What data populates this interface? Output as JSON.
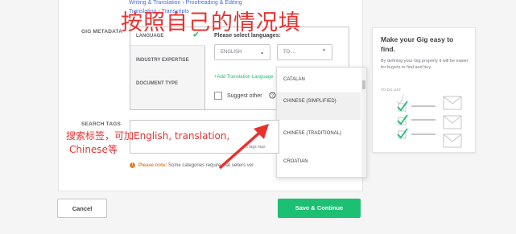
{
  "breadcrumb": {
    "line1": "Writing & Translation › Proofreading & Editing",
    "line2": "Translation › Transcripts"
  },
  "metadata": {
    "section_label": "GIG METADATA",
    "tabs": [
      {
        "label": "LANGUAGE",
        "done": true
      },
      {
        "label": "INDUSTRY EXPERTISE",
        "done": false
      },
      {
        "label": "DOCUMENT TYPE",
        "done": false
      }
    ],
    "select_label": "Please select languages:",
    "from_value": "ENGLISH",
    "to_placeholder": "TO ...",
    "add_link": "+Add Translation Language",
    "suggest_label": "Suggest other"
  },
  "dropdown": {
    "options": [
      {
        "label": "CATALAN",
        "highlighted": false
      },
      {
        "label": "CHINESE (SIMPLIFIED)",
        "highlighted": true
      },
      {
        "label": "CHINESE (TRADITIONAL)",
        "highlighted": false
      },
      {
        "label": "CROATIAN",
        "highlighted": false
      }
    ]
  },
  "tags": {
    "section_label": "SEARCH TAGS",
    "hint": "5 tags max"
  },
  "note": {
    "prefix": "Please note:",
    "text": "Some categories require that sellers ver"
  },
  "tip": {
    "title": "Make your Gig easy to find.",
    "body": "By defining your Gig properly it will be easier for buyers to find and buy.",
    "doodle_label": "TO-DO LIST"
  },
  "buttons": {
    "cancel": "Cancel",
    "save": "Save & Continue"
  },
  "annotations": {
    "top": "按照自己的情况填",
    "tags_line1": "搜索标签，可加English, translation,",
    "tags_line2": "Chinese等"
  },
  "colors": {
    "accent": "#1dbf73",
    "annotation": "#e8312f",
    "warning": "#e4862c"
  }
}
